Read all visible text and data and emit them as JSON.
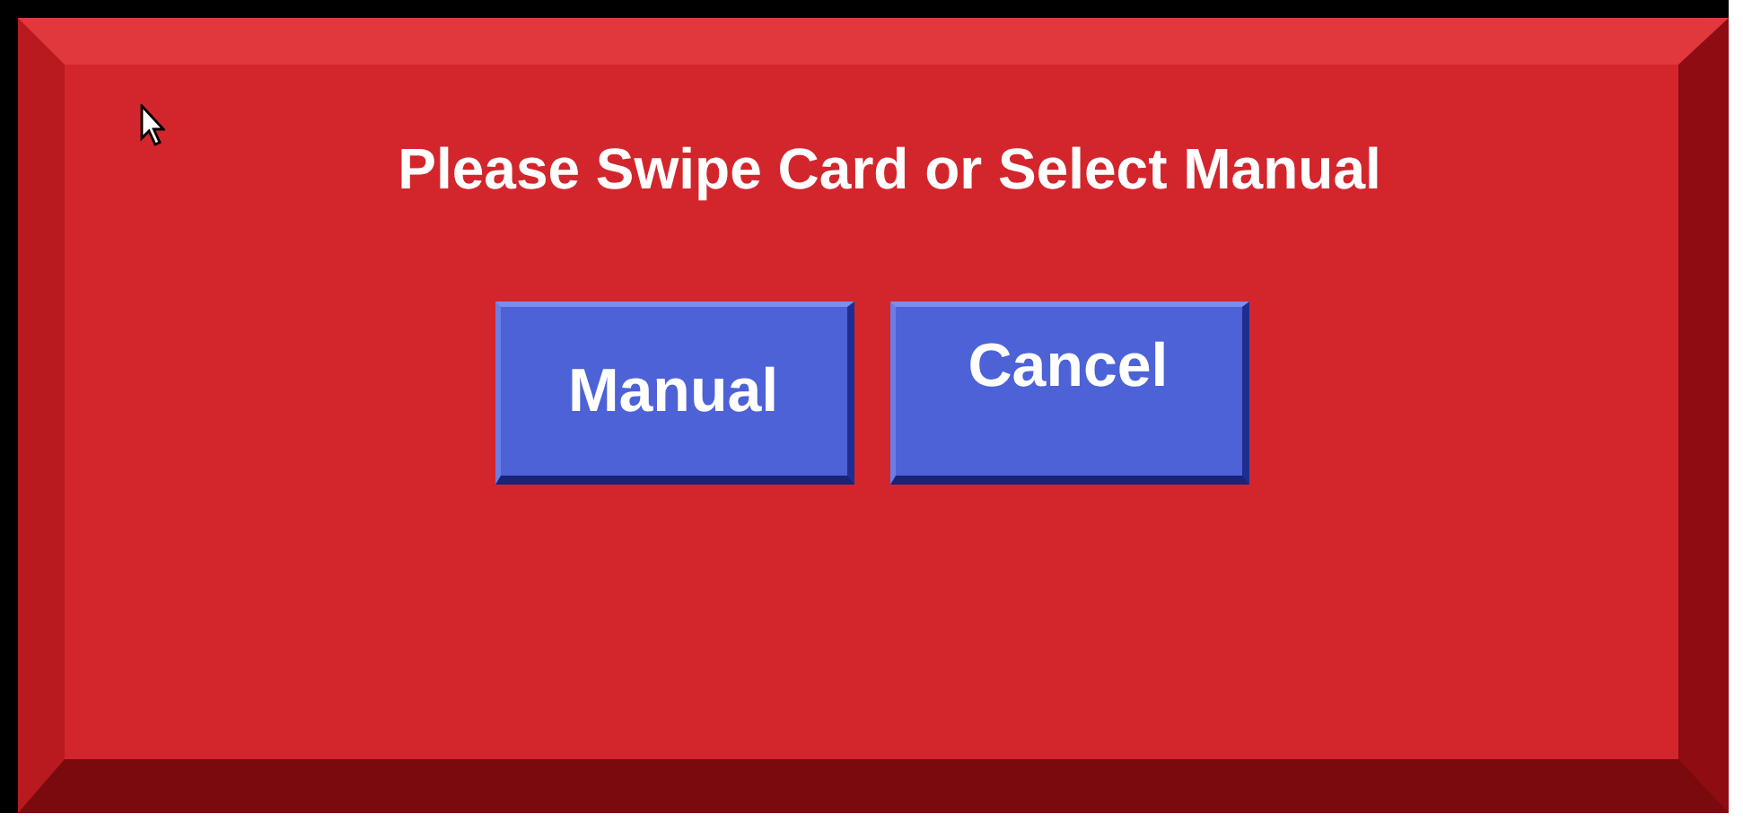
{
  "prompt": "Please Swipe Card or Select Manual",
  "buttons": [
    {
      "label": "Manual"
    },
    {
      "label": "Cancel"
    }
  ]
}
